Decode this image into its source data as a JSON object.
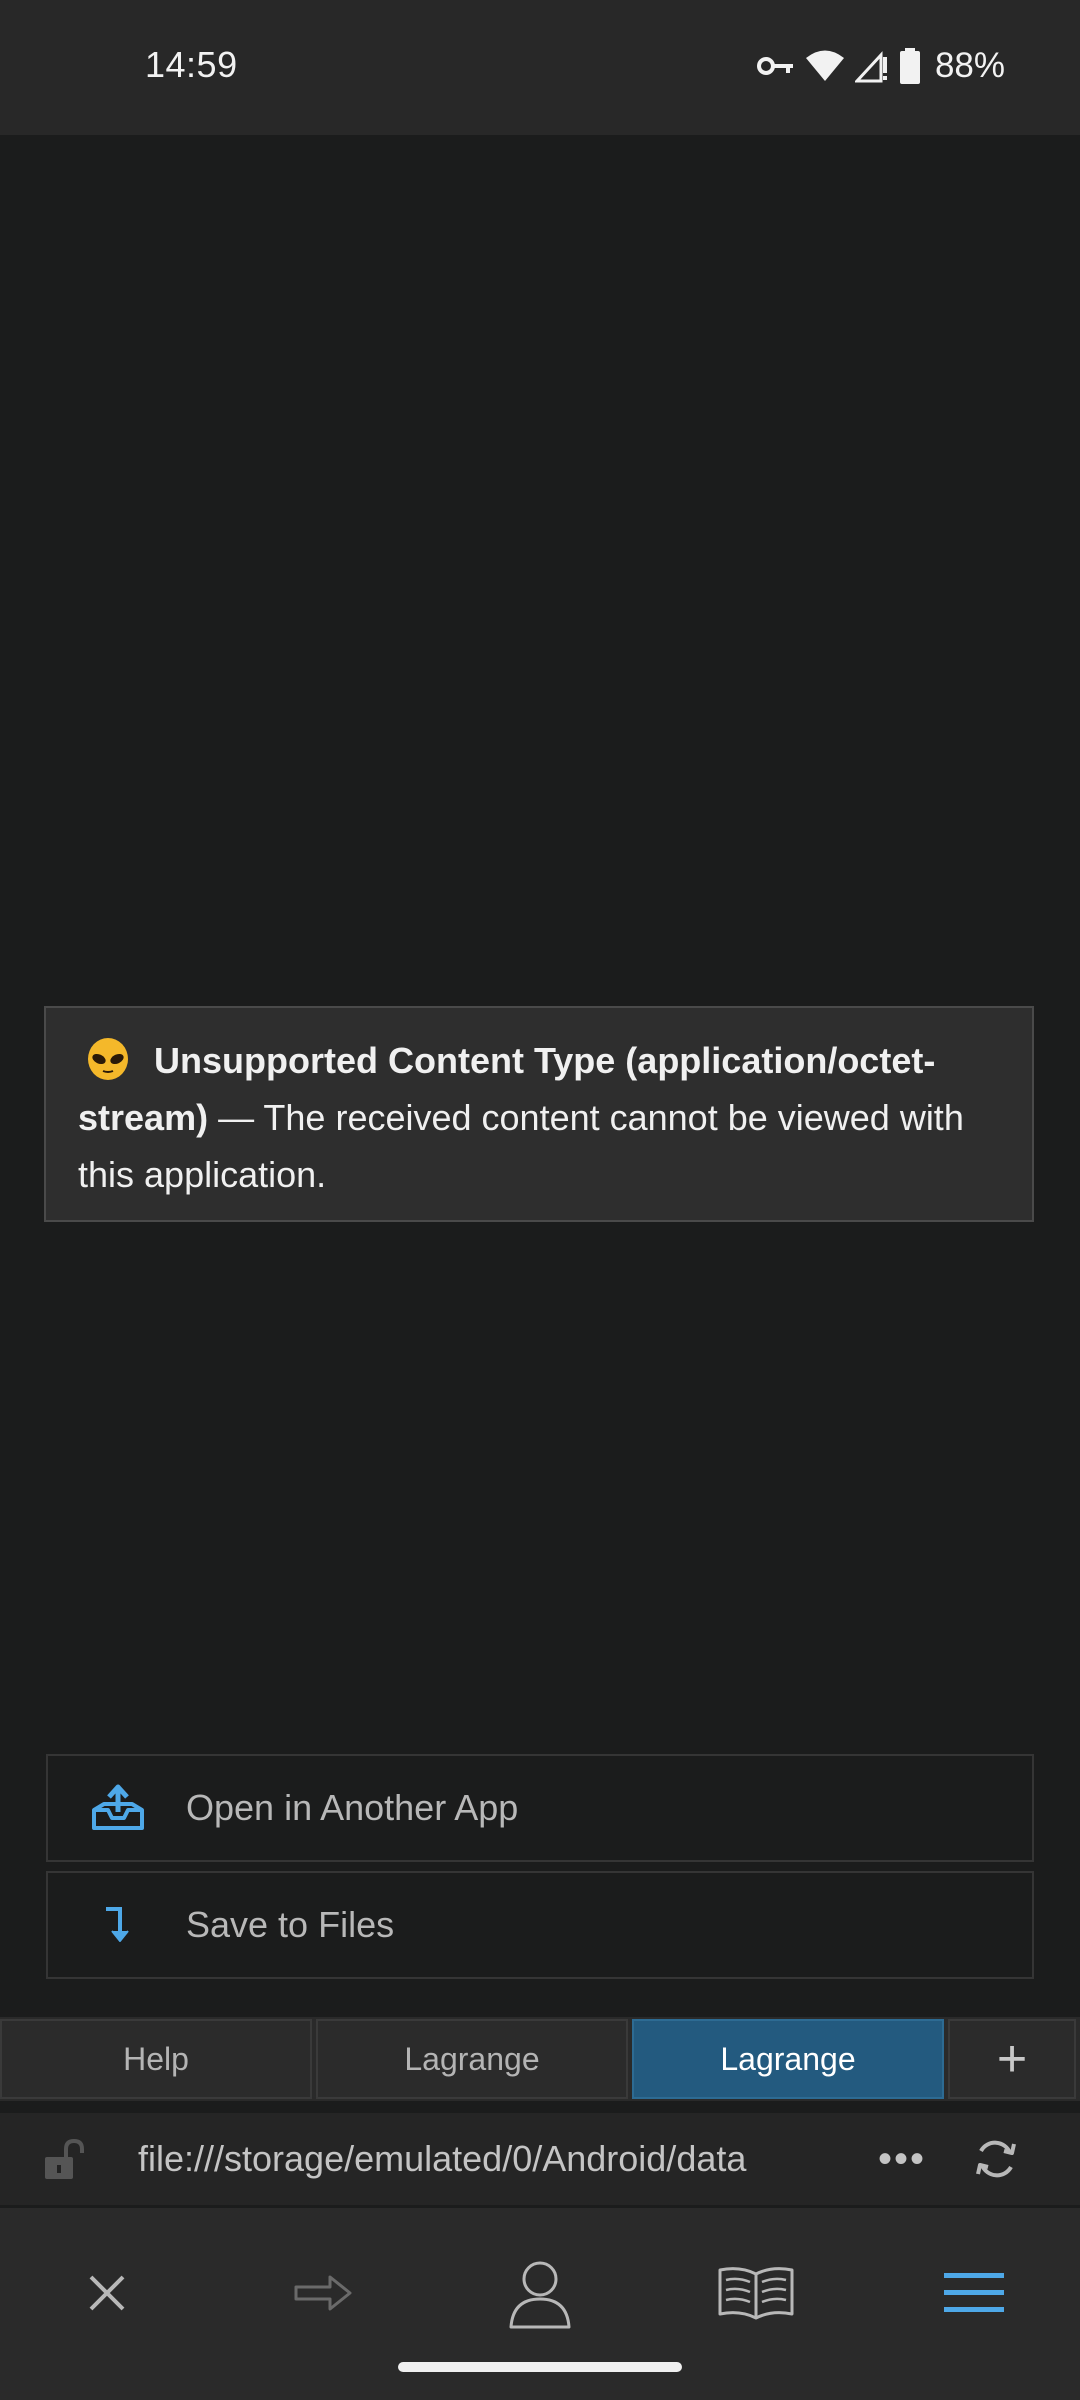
{
  "status_bar": {
    "time": "14:59",
    "battery_percent": "88%",
    "icons": [
      "vpn-key-icon",
      "wifi-icon",
      "signal-icon",
      "battery-icon"
    ]
  },
  "error": {
    "emoji": "alien-face-icon",
    "title": "Unsupported Content Type (application/octet-stream)",
    "message": " — The received content cannot be viewed with this application."
  },
  "actions": {
    "open_label": "Open in Another App",
    "save_label": "Save to Files"
  },
  "tabs": {
    "items": [
      {
        "label": "Help",
        "active": false
      },
      {
        "label": "Lagrange",
        "active": false
      },
      {
        "label": "Lagrange",
        "active": true
      }
    ],
    "add_label": "+"
  },
  "url_bar": {
    "url": "file:///storage/emulated/0/Android/data",
    "more_label": "•••"
  },
  "colors": {
    "background": "#1b1c1c",
    "accent": "#4ea8e8",
    "active_tab": "#235a7f"
  }
}
